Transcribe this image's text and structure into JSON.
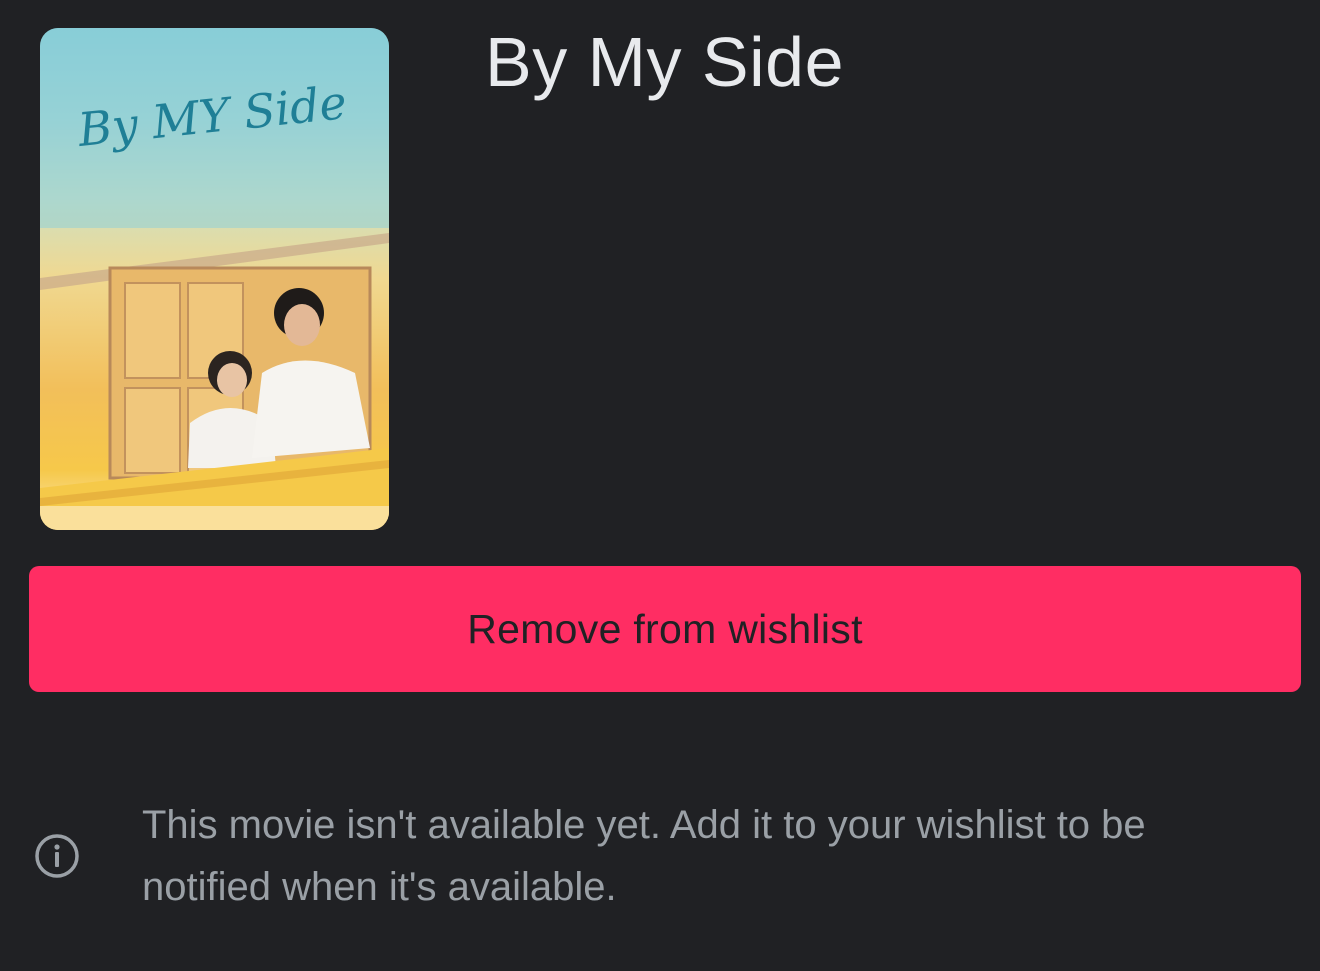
{
  "movie": {
    "title": "By My Side",
    "poster_title_text": "By MY Side"
  },
  "actions": {
    "wishlist_button_label": "Remove from wishlist"
  },
  "notice": {
    "icon": "info-icon",
    "text": "This movie isn't available yet. Add it to your wishlist to be notified when it's available."
  },
  "colors": {
    "background": "#202124",
    "accent": "#ff2d63",
    "title_text": "#e8eaed",
    "secondary_text": "#9aa0a6"
  }
}
